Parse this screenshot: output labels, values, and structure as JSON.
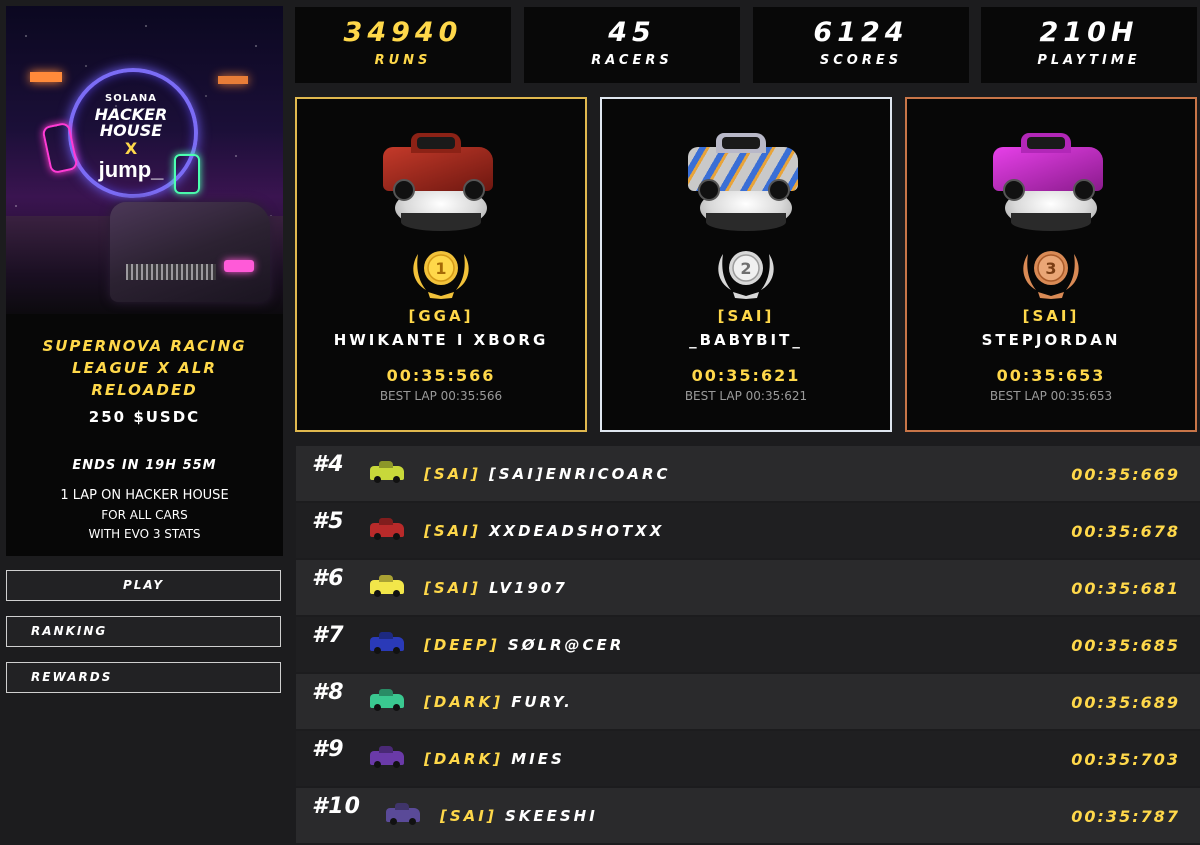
{
  "event": {
    "title_lines": [
      "SUPERNOVA RACING",
      "LEAGUE X ALR",
      "RELOADED"
    ],
    "prize": "250 $USDC",
    "ends": "ENDS IN 19H 55M",
    "desc_line1": "1 LAP ON HACKER HOUSE",
    "desc_line2": "FOR ALL CARS",
    "desc_line3": "WITH EVO 3 STATS",
    "poster": {
      "brand": "SOLANA",
      "line1": "HACKER HOUSE",
      "line2": "X",
      "line3": "jump_"
    }
  },
  "nav": {
    "play": "PLAY",
    "ranking": "RANKING",
    "rewards": "REWARDS"
  },
  "stats": [
    {
      "value": "34940",
      "label": "RUNS"
    },
    {
      "value": "45",
      "label": "RACERS"
    },
    {
      "value": "6124",
      "label": "SCORES"
    },
    {
      "value": "210H",
      "label": "PLAYTIME"
    }
  ],
  "podium": [
    {
      "place": "1",
      "tag": "[GGA]",
      "name": "HWIKANTE I XBORG",
      "time": "00:35:566",
      "best": "BEST LAP 00:35:566",
      "car": "red-sports-car",
      "medal_color": "#f2c23a"
    },
    {
      "place": "2",
      "tag": "[SAI]",
      "name": "_BABYBIT_",
      "time": "00:35:621",
      "best": "BEST LAP 00:35:621",
      "car": "camo-blue-car",
      "medal_color": "#d8d8d8"
    },
    {
      "place": "3",
      "tag": "[SAI]",
      "name": "STEPJORDAN",
      "time": "00:35:653",
      "best": "BEST LAP 00:35:653",
      "car": "pink-muscle-car",
      "medal_color": "#d98a55"
    }
  ],
  "leaderboard": [
    {
      "rank": "#4",
      "tag": "[SAI]",
      "name": "[SAI]ENRICOARC",
      "time": "00:35:669",
      "car_color": "#c8d83a"
    },
    {
      "rank": "#5",
      "tag": "[SAI]",
      "name": "XXDEADSHOTXX",
      "time": "00:35:678",
      "car_color": "#b82a2a"
    },
    {
      "rank": "#6",
      "tag": "[SAI]",
      "name": "LV1907",
      "time": "00:35:681",
      "car_color": "#f2e64a"
    },
    {
      "rank": "#7",
      "tag": "[DEEP]",
      "name": "SØLR@CER",
      "time": "00:35:685",
      "car_color": "#2a3ab8"
    },
    {
      "rank": "#8",
      "tag": "[DARK]",
      "name": "FURY.",
      "time": "00:35:689",
      "car_color": "#3ac890"
    },
    {
      "rank": "#9",
      "tag": "[DARK]",
      "name": "MIES",
      "time": "00:35:703",
      "car_color": "#6a3aa8"
    },
    {
      "rank": "#10",
      "tag": "[SAI]",
      "name": "SKEESHI",
      "time": "00:35:787",
      "car_color": "#5a4a98"
    }
  ],
  "colors": {
    "accent": "#ffd84a",
    "gold": "#e0b84e",
    "silver": "#dfe6ef",
    "bronze": "#c87548"
  }
}
